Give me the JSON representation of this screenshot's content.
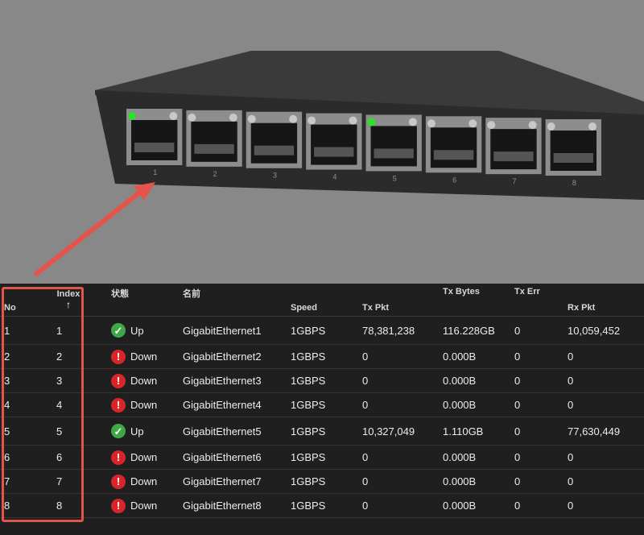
{
  "switch": {
    "port_labels": [
      "1",
      "2",
      "3",
      "4",
      "5",
      "6",
      "7",
      "8"
    ],
    "port_led_active": [
      true,
      false,
      false,
      false,
      true,
      false,
      false,
      false
    ]
  },
  "colors": {
    "up": "#3fa847",
    "down": "#d8252a",
    "highlight": "#e5544a",
    "led_on": "#2ee02e"
  },
  "table": {
    "headers": {
      "no": "No",
      "index": "Index",
      "index_sort_icon": "arrow-up-icon",
      "status": "状態",
      "name": "名前",
      "speed": "Speed",
      "tx_pkt": "Tx Pkt",
      "tx_bytes": "Tx Bytes",
      "tx_err": "Tx Err",
      "rx_pkt": "Rx Pkt"
    },
    "rows": [
      {
        "no": "1",
        "index": "1",
        "status": "Up",
        "status_icon": "check-circle-icon",
        "name": "GigabitEthernet1",
        "speed": "1GBPS",
        "tx_pkt": "78,381,238",
        "tx_bytes": "116.228GB",
        "tx_err": "0",
        "rx_pkt": "10,059,452"
      },
      {
        "no": "2",
        "index": "2",
        "status": "Down",
        "status_icon": "alert-circle-icon",
        "name": "GigabitEthernet2",
        "speed": "1GBPS",
        "tx_pkt": "0",
        "tx_bytes": "0.000B",
        "tx_err": "0",
        "rx_pkt": "0"
      },
      {
        "no": "3",
        "index": "3",
        "status": "Down",
        "status_icon": "alert-circle-icon",
        "name": "GigabitEthernet3",
        "speed": "1GBPS",
        "tx_pkt": "0",
        "tx_bytes": "0.000B",
        "tx_err": "0",
        "rx_pkt": "0"
      },
      {
        "no": "4",
        "index": "4",
        "status": "Down",
        "status_icon": "alert-circle-icon",
        "name": "GigabitEthernet4",
        "speed": "1GBPS",
        "tx_pkt": "0",
        "tx_bytes": "0.000B",
        "tx_err": "0",
        "rx_pkt": "0"
      },
      {
        "no": "5",
        "index": "5",
        "status": "Up",
        "status_icon": "check-circle-icon",
        "name": "GigabitEthernet5",
        "speed": "1GBPS",
        "tx_pkt": "10,327,049",
        "tx_bytes": "1.110GB",
        "tx_err": "0",
        "rx_pkt": "77,630,449"
      },
      {
        "no": "6",
        "index": "6",
        "status": "Down",
        "status_icon": "alert-circle-icon",
        "name": "GigabitEthernet6",
        "speed": "1GBPS",
        "tx_pkt": "0",
        "tx_bytes": "0.000B",
        "tx_err": "0",
        "rx_pkt": "0"
      },
      {
        "no": "7",
        "index": "7",
        "status": "Down",
        "status_icon": "alert-circle-icon",
        "name": "GigabitEthernet7",
        "speed": "1GBPS",
        "tx_pkt": "0",
        "tx_bytes": "0.000B",
        "tx_err": "0",
        "rx_pkt": "0"
      },
      {
        "no": "8",
        "index": "8",
        "status": "Down",
        "status_icon": "alert-circle-icon",
        "name": "GigabitEthernet8",
        "speed": "1GBPS",
        "tx_pkt": "0",
        "tx_bytes": "0.000B",
        "tx_err": "0",
        "rx_pkt": "0"
      }
    ]
  }
}
